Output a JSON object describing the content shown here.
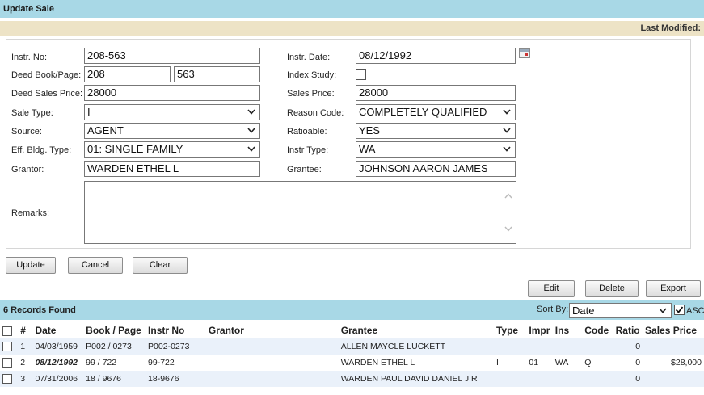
{
  "header": {
    "title": "Update Sale",
    "last_modified_label": "Last Modified:"
  },
  "form": {
    "instr_no": {
      "label": "Instr. No:",
      "value": "208-563"
    },
    "instr_date": {
      "label": "Instr. Date:",
      "value": "08/12/1992"
    },
    "deed_book_page": {
      "label": "Deed Book/Page:",
      "book": "208",
      "page": "563"
    },
    "index_study": {
      "label": "Index Study:",
      "checked": false
    },
    "deed_sales_price": {
      "label": "Deed Sales Price:",
      "value": "28000"
    },
    "sales_price": {
      "label": "Sales Price:",
      "value": "28000"
    },
    "sale_type": {
      "label": "Sale Type:",
      "value": "I"
    },
    "reason_code": {
      "label": "Reason Code:",
      "value": "COMPLETELY QUALIFIED"
    },
    "source": {
      "label": "Source:",
      "value": "AGENT"
    },
    "ratioable": {
      "label": "Ratioable:",
      "value": "YES"
    },
    "eff_bldg_type": {
      "label": "Eff. Bldg. Type:",
      "value": "01: SINGLE FAMILY"
    },
    "instr_type": {
      "label": "Instr Type:",
      "value": "WA"
    },
    "grantor": {
      "label": "Grantor:",
      "value": "WARDEN ETHEL L"
    },
    "grantee": {
      "label": "Grantee:",
      "value": "JOHNSON AARON JAMES"
    },
    "remarks": {
      "label": "Remarks:",
      "value": ""
    }
  },
  "buttons": {
    "update": "Update",
    "cancel": "Cancel",
    "clear": "Clear",
    "edit": "Edit",
    "delete": "Delete",
    "export": "Export"
  },
  "results": {
    "count_label": "6 Records Found",
    "sort_by_label": "Sort By:",
    "sort_by_value": "Date",
    "asc_label": "ASC",
    "asc_checked": true,
    "columns": [
      "#",
      "Date",
      "Book / Page",
      "Instr No",
      "Grantor",
      "Grantee",
      "Type",
      "Impr",
      "Ins",
      "Code",
      "Ratio",
      "Sales Price"
    ],
    "rows": [
      {
        "n": "1",
        "date": "04/03/1959",
        "book_page": "P002 / 0273",
        "instr_no": "P002-0273",
        "grantor": "",
        "grantee": "ALLEN MAYCLE LUCKETT",
        "type": "",
        "impr": "",
        "ins": "",
        "code": "",
        "ratio": "0",
        "price": ""
      },
      {
        "n": "2",
        "date": "08/12/1992",
        "book_page": "99 / 722",
        "instr_no": "99-722",
        "grantor": "",
        "grantee": "WARDEN ETHEL L",
        "type": "I",
        "impr": "01",
        "ins": "WA",
        "code": "Q",
        "ratio": "0",
        "price": "$28,000"
      },
      {
        "n": "3",
        "date": "07/31/2006",
        "book_page": "18 / 9676",
        "instr_no": "18-9676",
        "grantor": "",
        "grantee": "WARDEN PAUL DAVID DANIEL J R",
        "type": "",
        "impr": "",
        "ins": "",
        "code": "",
        "ratio": "0",
        "price": ""
      }
    ]
  }
}
